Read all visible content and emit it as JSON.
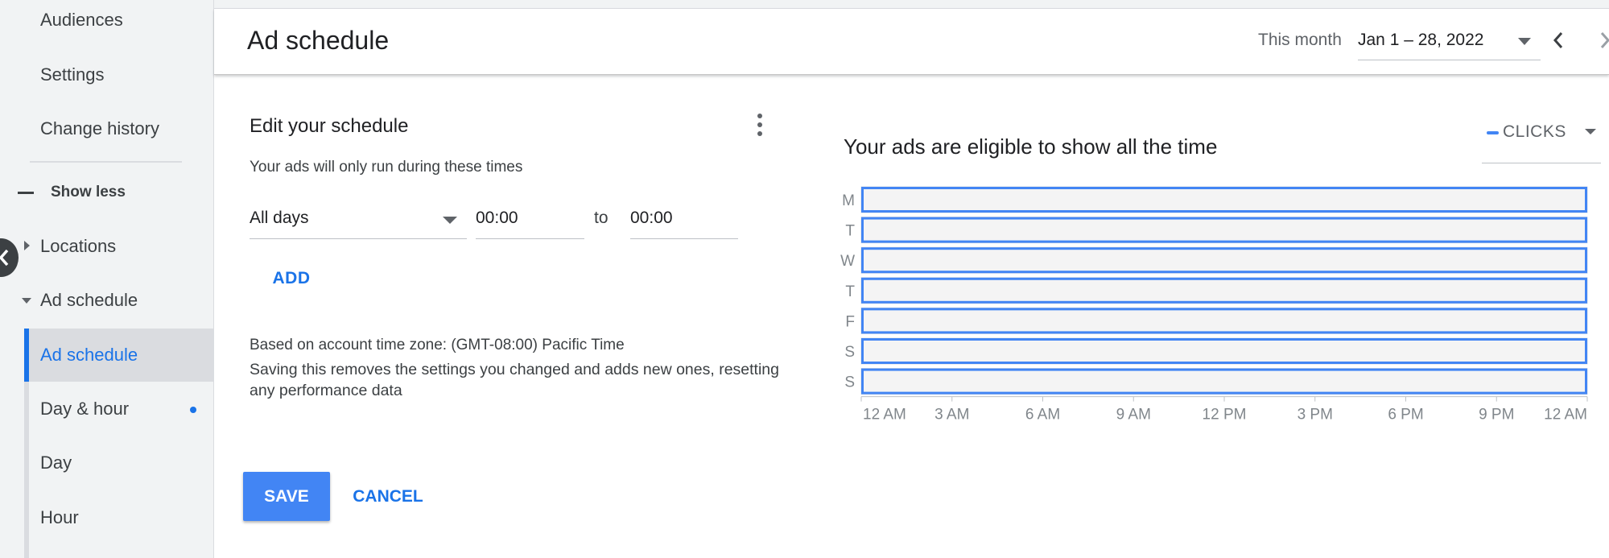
{
  "sidebar": {
    "items": [
      {
        "label": "Audiences"
      },
      {
        "label": "Settings"
      },
      {
        "label": "Change history"
      }
    ],
    "show_less": "Show less",
    "sections": [
      {
        "label": "Locations"
      },
      {
        "label": "Ad schedule"
      }
    ],
    "sub_items": [
      {
        "label": "Ad schedule",
        "active": true
      },
      {
        "label": "Day & hour"
      },
      {
        "label": "Day"
      },
      {
        "label": "Hour"
      }
    ],
    "accent": "#1a73e8"
  },
  "header": {
    "title": "Ad schedule",
    "range_label": "This month",
    "range_value": "Jan 1 – 28, 2022"
  },
  "schedule": {
    "title": "Edit your schedule",
    "subtitle": "Your ads will only run during these times",
    "days_value": "All days",
    "start_time": "00:00",
    "to_label": "to",
    "end_time": "00:00",
    "add_label": "ADD",
    "timezone_text": "Based on account time zone: (GMT-08:00) Pacific Time",
    "warning_text": "Saving this removes the settings you changed and adds new ones, resetting any performance data",
    "save_label": "SAVE",
    "cancel_label": "CANCEL"
  },
  "chart": {
    "title": "Your ads are eligible to show all the time",
    "metric": "CLICKS",
    "series_color": "#4285f4"
  },
  "chart_data": {
    "type": "heatmap",
    "title": "Your ads are eligible to show all the time",
    "rows": [
      "M",
      "T",
      "W",
      "T",
      "F",
      "S",
      "S"
    ],
    "x_ticks": [
      "12 AM",
      "3 AM",
      "6 AM",
      "9 AM",
      "12 PM",
      "3 PM",
      "6 PM",
      "9 PM",
      "12 AM"
    ],
    "x_range_hours": [
      0,
      24
    ],
    "scheduled_windows": [
      {
        "day": "M",
        "start_hour": 0,
        "end_hour": 24
      },
      {
        "day": "T",
        "start_hour": 0,
        "end_hour": 24
      },
      {
        "day": "W",
        "start_hour": 0,
        "end_hour": 24
      },
      {
        "day": "T",
        "start_hour": 0,
        "end_hour": 24
      },
      {
        "day": "F",
        "start_hour": 0,
        "end_hour": 24
      },
      {
        "day": "S",
        "start_hour": 0,
        "end_hour": 24
      },
      {
        "day": "S",
        "start_hour": 0,
        "end_hour": 24
      }
    ],
    "metric": "CLICKS"
  }
}
